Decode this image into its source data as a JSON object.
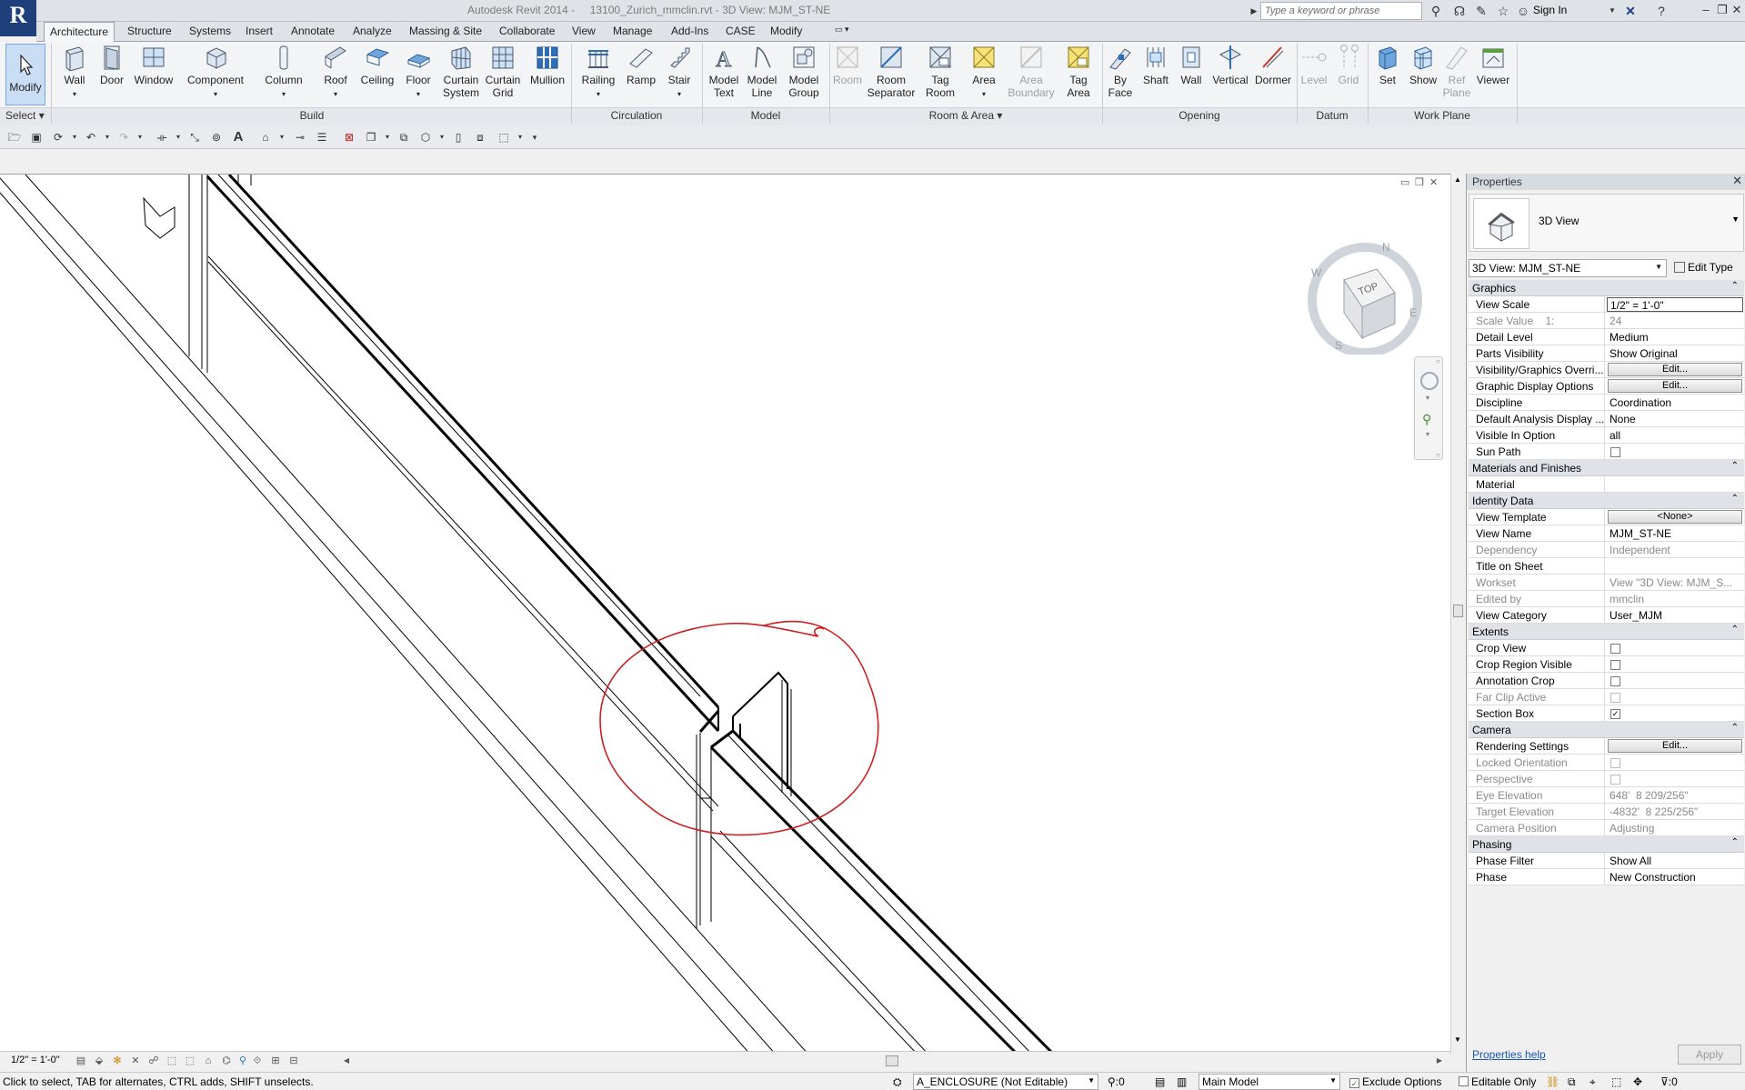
{
  "title_bar": {
    "app_title": "Autodesk Revit 2014 -     13100_Zurich_mmclin.rvt - 3D View: MJM_ST-NE",
    "search_placeholder": "Type a keyword or phrase",
    "sign_in": "Sign In"
  },
  "tabs": [
    "Architecture",
    "Structure",
    "Systems",
    "Insert",
    "Annotate",
    "Analyze",
    "Massing & Site",
    "Collaborate",
    "View",
    "Manage",
    "Add-Ins",
    "CASE",
    "Modify"
  ],
  "ribbon": {
    "modify": "Modify",
    "select_panel": "Select",
    "build": [
      "Wall",
      "Door",
      "Window",
      "Component",
      "Column",
      "Roof",
      "Ceiling",
      "Floor",
      "Curtain\nSystem",
      "Curtain\nGrid",
      "Mullion"
    ],
    "build_label": "Build",
    "circulation": [
      "Railing",
      "Ramp",
      "Stair"
    ],
    "circulation_label": "Circulation",
    "model": [
      "Model\nText",
      "Model\nLine",
      "Model\nGroup"
    ],
    "model_label": "Model",
    "room_area": [
      "Room",
      "Room\nSeparator",
      "Tag\nRoom",
      "Area",
      "Area\nBoundary",
      "Tag\nArea"
    ],
    "room_area_label": "Room & Area",
    "opening": [
      "By\nFace",
      "Shaft",
      "Wall",
      "Vertical",
      "Dormer"
    ],
    "opening_label": "Opening",
    "datum": [
      "Level",
      "Grid"
    ],
    "datum_label": "Datum",
    "work_plane": [
      "Set",
      "Show",
      "Ref\nPlane",
      "Viewer"
    ],
    "work_plane_label": "Work Plane"
  },
  "viewcube": {
    "face": "TOP",
    "n": "N",
    "e": "E",
    "s": "S",
    "w": "W"
  },
  "view_control": {
    "scale": "1/2\" = 1'-0\""
  },
  "status_bar": {
    "hint": "Click to select, TAB for alternates, CTRL adds, SHIFT unselects.",
    "workset": "A_ENCLOSURE (Not Editable)",
    "count_a": ":0",
    "design_option": "Main Model",
    "exclude_options": "Exclude Options",
    "editable_only": "Editable Only",
    "filter_count": ":0"
  },
  "properties": {
    "title": "Properties",
    "type_name": "3D View",
    "instance_selector": "3D View: MJM_ST-NE",
    "edit_type": "Edit Type",
    "help": "Properties help",
    "apply": "Apply",
    "groups": {
      "graphics": "Graphics",
      "materials": "Materials and Finishes",
      "identity": "Identity Data",
      "extents": "Extents",
      "camera": "Camera",
      "phasing": "Phasing"
    },
    "rows": {
      "view_scale": [
        "View Scale",
        "1/2\" = 1'-0\""
      ],
      "scale_value": [
        "Scale Value    1:",
        "24"
      ],
      "detail_level": [
        "Detail Level",
        "Medium"
      ],
      "parts_visibility": [
        "Parts Visibility",
        "Show Original"
      ],
      "vg_overrides": [
        "Visibility/Graphics Overri...",
        "Edit..."
      ],
      "graphic_display": [
        "Graphic Display Options",
        "Edit..."
      ],
      "discipline": [
        "Discipline",
        "Coordination"
      ],
      "default_analysis": [
        "Default Analysis Display ...",
        "None"
      ],
      "visible_in_option": [
        "Visible In Option",
        "all"
      ],
      "sun_path": [
        "Sun Path",
        ""
      ],
      "material": [
        "Material",
        ""
      ],
      "view_template": [
        "View Template",
        "<None>"
      ],
      "view_name": [
        "View Name",
        "MJM_ST-NE"
      ],
      "dependency": [
        "Dependency",
        "Independent"
      ],
      "title_on_sheet": [
        "Title on Sheet",
        ""
      ],
      "workset": [
        "Workset",
        "View \"3D View: MJM_S..."
      ],
      "edited_by": [
        "Edited by",
        "mmclin"
      ],
      "view_category": [
        "View Category",
        "User_MJM"
      ],
      "crop_view": [
        "Crop View",
        ""
      ],
      "crop_region_visible": [
        "Crop Region Visible",
        ""
      ],
      "annotation_crop": [
        "Annotation Crop",
        ""
      ],
      "far_clip_active": [
        "Far Clip Active",
        ""
      ],
      "section_box": [
        "Section Box",
        "✓"
      ],
      "rendering_settings": [
        "Rendering Settings",
        "Edit..."
      ],
      "locked_orientation": [
        "Locked Orientation",
        ""
      ],
      "perspective": [
        "Perspective",
        ""
      ],
      "eye_elevation": [
        "Eye Elevation",
        "648'  8 209/256\""
      ],
      "target_elevation": [
        "Target Elevation",
        "-4832'  8 225/256\""
      ],
      "camera_position": [
        "Camera Position",
        "Adjusting"
      ],
      "phase_filter": [
        "Phase Filter",
        "Show All"
      ],
      "phase": [
        "Phase",
        "New Construction"
      ]
    }
  },
  "colors": {
    "annotation_circle": "#cc1f1f",
    "ribbon_highlight": "#c9ddf4",
    "link": "#1a56b8"
  }
}
